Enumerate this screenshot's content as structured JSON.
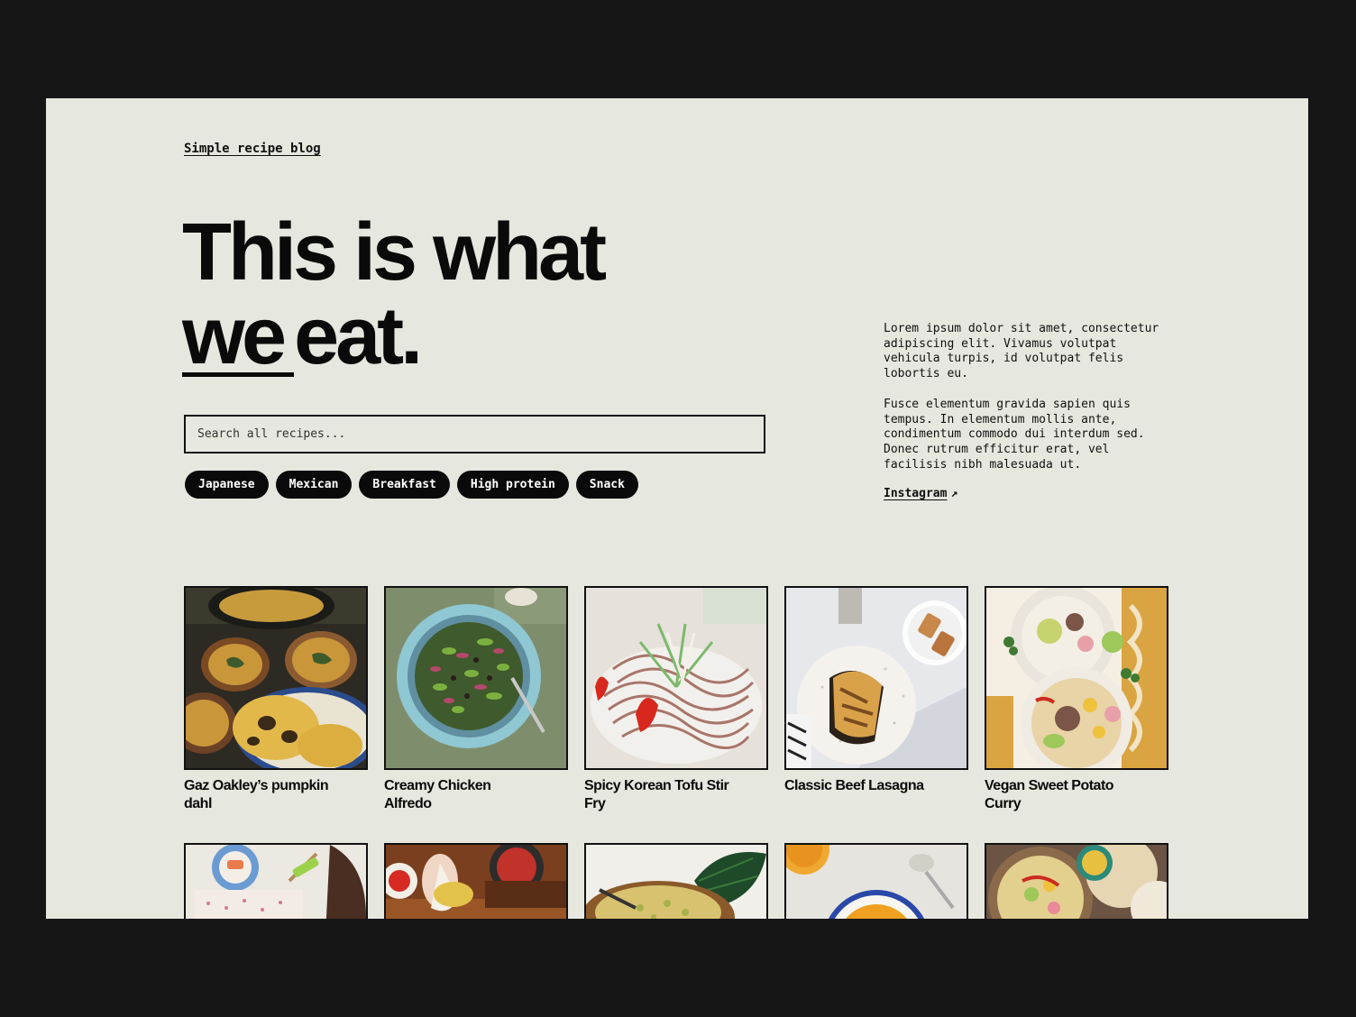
{
  "header": {
    "brand": "Simple recipe blog"
  },
  "hero": {
    "line1": "This is what",
    "line2_underlined": "we",
    "line2_rest": "eat."
  },
  "search": {
    "placeholder": "Search all recipes..."
  },
  "tags": [
    "Japanese",
    "Mexican",
    "Breakfast",
    "High protein",
    "Snack"
  ],
  "about": {
    "paragraphs": [
      "Lorem ipsum dolor sit amet, consectetur adipiscing elit. Vivamus volutpat vehicula turpis, id volutpat felis lobortis eu.",
      "Fusce elementum gravida sapien quis tempus. In elementum mollis ante, condimentum commodo dui interdum sed. Donec rutrum efficitur erat, vel facilisis nibh malesuada ut."
    ],
    "instagram_label": "Instagram",
    "instagram_icon": "arrow-up-right-icon"
  },
  "recipes": [
    {
      "title": "Gaz Oakley’s pumpkin dahl"
    },
    {
      "title": "Creamy Chicken Alfredo"
    },
    {
      "title": "Spicy Korean Tofu Stir Fry"
    },
    {
      "title": "Classic Beef Lasagna"
    },
    {
      "title": "Vegan Sweet Potato Curry"
    }
  ],
  "colors": {
    "page_bg": "#e6e7de",
    "outer_bg": "#161616",
    "ink": "#0a0a0a"
  }
}
